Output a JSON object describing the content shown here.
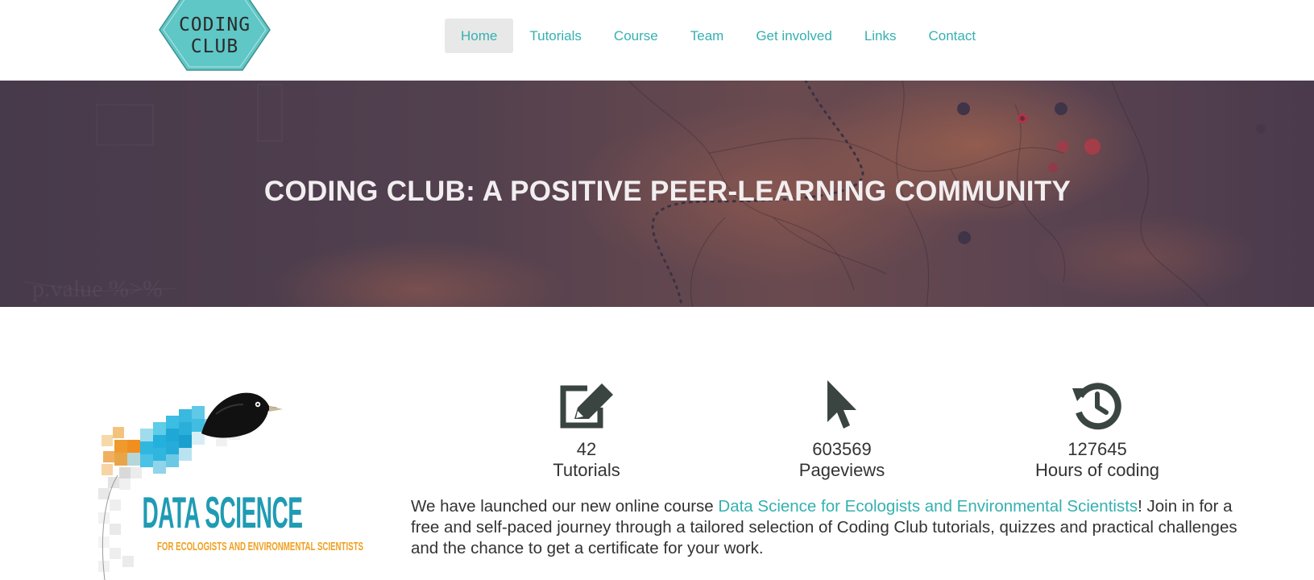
{
  "logo": {
    "line1": "CODING",
    "line2": "CLUB",
    "fill": "#5fc7c6"
  },
  "nav": {
    "items": [
      "Home",
      "Tutorials",
      "Course",
      "Team",
      "Get involved",
      "Links",
      "Contact"
    ],
    "active": "Home",
    "color": "#36b0b0"
  },
  "hero": {
    "title": "CODING CLUB: A POSITIVE PEER-LEARNING COMMUNITY"
  },
  "course_logo": {
    "title": "DATA SCIENCE",
    "subtitle": "FOR ECOLOGISTS AND ENVIRONMENTAL SCIENTISTS"
  },
  "stats": [
    {
      "icon": "edit-icon",
      "number": "42",
      "label": "Tutorials"
    },
    {
      "icon": "cursor-pointer-icon",
      "number": "603569",
      "label": "Pageviews"
    },
    {
      "icon": "history-icon",
      "number": "127645",
      "label": "Hours of coding"
    }
  ],
  "description": {
    "before": "We have launched our new online course ",
    "link": "Data Science for Ecologists and Environmental Scientists",
    "after": "! Join in for a free and self-paced journey through a tailored selection of Coding Club tutorials, quizzes and practical challenges and the chance to get a certificate for your work."
  },
  "colors": {
    "accent": "#36b0b0",
    "icon": "#3a4542",
    "hero_text": "#f2eef0"
  }
}
